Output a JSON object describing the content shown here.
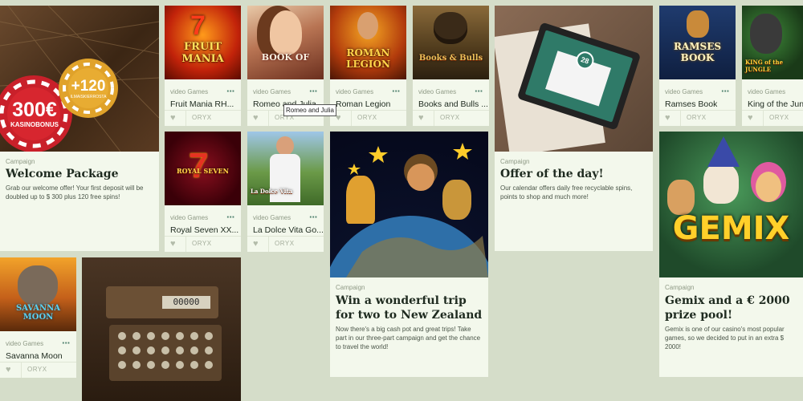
{
  "welcome": {
    "chip_large": "300€",
    "chip_large_sub": "KASINOBONUS",
    "chip_small": "+120",
    "chip_small_sub": "ILMAISKIERROSTA",
    "label": "Campaign",
    "title": "Welcome Package",
    "text": "Grab our welcome offer! Your first deposit will be doubled up to $ 300 plus 120 free spins!"
  },
  "games": [
    {
      "category": "video Games",
      "name": "Fruit Mania RH...",
      "provider": "ORYX",
      "art_text": "FRUIT MANIA"
    },
    {
      "category": "video Games",
      "name": "Romeo and Julia",
      "provider": "ORYX",
      "art_text": "BOOK OF"
    },
    {
      "category": "video Games",
      "name": "Roman Legion",
      "provider": "ORYX",
      "art_text": "ROMAN LEGION"
    },
    {
      "category": "video Games",
      "name": "Books and Bulls ...",
      "provider": "ORYX",
      "art_text": "Books & Bulls"
    },
    {
      "category": "video Games",
      "name": "Ramses Book",
      "provider": "ORYX",
      "art_text": "RAMSES BOOK"
    },
    {
      "category": "video Games",
      "name": "King of the Jun",
      "provider": "ORYX",
      "art_text": "KING of the JUNGLE"
    },
    {
      "category": "video Games",
      "name": "Royal Seven XX...",
      "provider": "ORYX",
      "art_text": "ROYAL SEVEN"
    },
    {
      "category": "video Games",
      "name": "La Dolce Vita Go...",
      "provider": "ORYX",
      "art_text": "La Dolce Vita"
    },
    {
      "category": "video Games",
      "name": "Savanna Moon",
      "provider": "ORYX",
      "art_text": "SAVANNA MOON"
    }
  ],
  "tooltip": "Romeo and Julia",
  "offer": {
    "calendar_day": "28",
    "label": "Campaign",
    "title": "Offer of the day!",
    "text": "Our calendar offers daily free recyclable spins, points to shop and much more!"
  },
  "trip": {
    "label": "Campaign",
    "title": "Win a wonderful trip for two to New Zealand",
    "text": "Now there's a big cash pot and great trips! Take part in our three-part campaign and get the chance to travel the world!"
  },
  "gemix": {
    "art_text": "GEMIX",
    "label": "Campaign",
    "title": "Gemix and a € 2000 prize pool!",
    "text": "Gemix is one of our casino's most popular games, so we decided to put in an extra $ 2000!"
  },
  "register": {
    "display": "00000"
  },
  "icons": {
    "heart": "heart-icon",
    "more": "more-dots-icon"
  }
}
